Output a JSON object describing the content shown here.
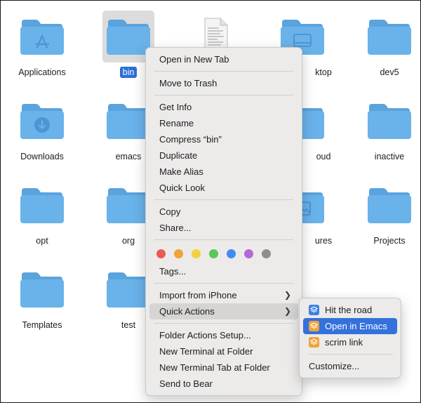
{
  "desktop": {
    "items": [
      {
        "label": "Applications",
        "emblem": "apps-emblem"
      },
      {
        "label": "bin",
        "selected": true
      },
      {
        "label": "",
        "kind": "document"
      },
      {
        "label": "ktop",
        "emblem": "desktop-emblem"
      },
      {
        "label": "dev5"
      },
      {
        "label": "Downloads",
        "emblem": "download-emblem"
      },
      {
        "label": "emacs"
      },
      {
        "label": "oud"
      },
      {
        "label": "inactive"
      },
      {
        "label": "opt"
      },
      {
        "label": "org"
      },
      {
        "label": "ures",
        "emblem": "pictures-emblem"
      },
      {
        "label": "Projects"
      },
      {
        "label": "Templates"
      },
      {
        "label": "test"
      }
    ]
  },
  "context_menu": {
    "open_in_new_tab": "Open in New Tab",
    "move_to_trash": "Move to Trash",
    "get_info": "Get Info",
    "rename": "Rename",
    "compress": "Compress “bin”",
    "duplicate": "Duplicate",
    "make_alias": "Make Alias",
    "quick_look": "Quick Look",
    "copy": "Copy",
    "share": "Share...",
    "tags_label": "Tags...",
    "import_from_iphone": "Import from iPhone",
    "quick_actions": "Quick Actions",
    "folder_actions_setup": "Folder Actions Setup...",
    "new_terminal_at_folder": "New Terminal at Folder",
    "new_terminal_tab_at_folder": "New Terminal Tab at Folder",
    "send_to_bear": "Send to Bear",
    "tag_colors": [
      "#e95c53",
      "#f0a33a",
      "#f5d140",
      "#5bc65b",
      "#3f8cf2",
      "#b567d6",
      "#8e8e8e"
    ]
  },
  "quick_actions_menu": {
    "items": [
      {
        "label": "Hit the road",
        "icon_color": "#3d7fe6"
      },
      {
        "label": "Open in Emacs",
        "icon_color": "#f0a33a",
        "selected": true
      },
      {
        "label": "scrim link",
        "icon_color": "#f0a33a"
      }
    ],
    "customize": "Customize..."
  },
  "colors": {
    "folder": "#69b2ea",
    "folder_tab": "#5aa3dd",
    "selection": "#2a6fd6",
    "menu_highlight": "#3471dc"
  }
}
